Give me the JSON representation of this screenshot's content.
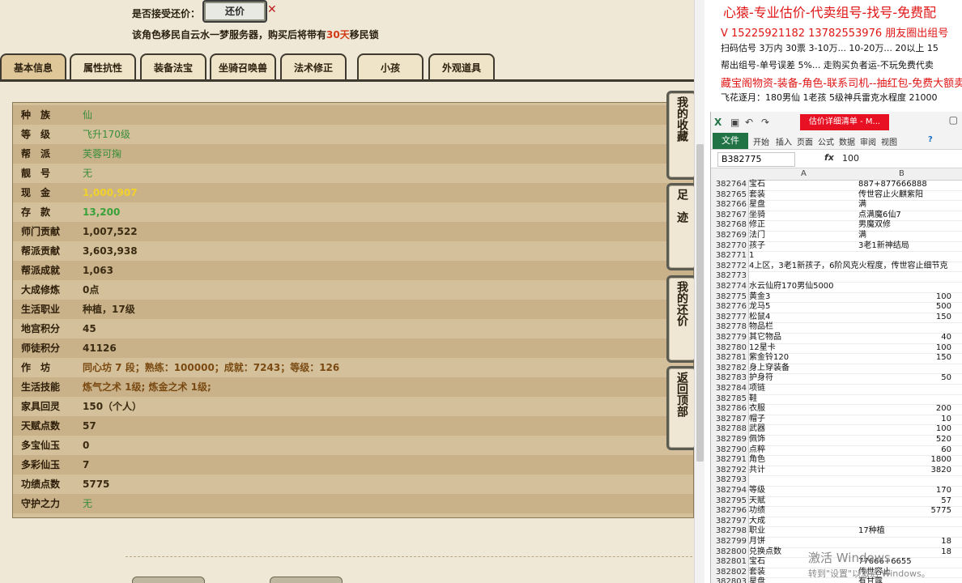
{
  "offer": {
    "question": "是否接受还价：",
    "button": "还价",
    "close": "✕"
  },
  "migration": {
    "prefix": "该角色移民自云水一梦服务器，购买后将带有",
    "days": "30天",
    "suffix": "移民锁"
  },
  "tabs": [
    "基本信息",
    "属性抗性",
    "装备法宝",
    "坐骑召唤兽",
    "法术修正",
    "小孩",
    "外观道具"
  ],
  "info": [
    {
      "k": "种　族",
      "v": "仙"
    },
    {
      "k": "等　级",
      "v": "飞升170级"
    },
    {
      "k": "帮　派",
      "v": "芙蓉可掬"
    },
    {
      "k": "靓　号",
      "v": "无"
    },
    {
      "k": "现　金",
      "v": "1,000,907"
    },
    {
      "k": "存　款",
      "v": "13,200"
    },
    {
      "k": "师门贡献",
      "v": "1,007,522"
    },
    {
      "k": "帮派贡献",
      "v": "3,603,938"
    },
    {
      "k": "帮派成就",
      "v": "1,063"
    },
    {
      "k": "大成修炼",
      "v": "0点"
    },
    {
      "k": "生活职业",
      "v": "种植，17级"
    },
    {
      "k": "地宫积分",
      "v": "45"
    },
    {
      "k": "师徒积分",
      "v": "41126"
    },
    {
      "k": "作　坊",
      "v": "同心坊 7 段；熟练：100000；成就：7243；等级：126"
    },
    {
      "k": "生活技能",
      "v": "炼气之术 1级; 炼金之术 1级;"
    },
    {
      "k": "家具回灵",
      "v": "150（个人）"
    },
    {
      "k": "天赋点数",
      "v": "57"
    },
    {
      "k": "多宝仙玉",
      "v": "0"
    },
    {
      "k": "多彩仙玉",
      "v": "7"
    },
    {
      "k": "功绩点数",
      "v": "5775"
    },
    {
      "k": "守护之力",
      "v": "无"
    }
  ],
  "side_buttons": [
    "我的收藏",
    "足迹",
    "我的还价",
    "返回顶部"
  ],
  "ads": {
    "line1": "心猿-专业估价-代卖组号-找号-免费配",
    "line2": "V 15225921182    13782553976 朋友圈出组号",
    "line3": "扫码估号 3万内 30票  3-10万... 10-20万... 20以上 15",
    "line4": "帮出组号-单号误差 5%... 走购买负者运-不玩免费代卖",
    "line5": "藏宝阁物资-装备-角色-联系司机--抽红包-免费大额卖",
    "line6": "飞花逐月：180男仙 1老孩 5级神兵雷克水程度 21000"
  },
  "excel": {
    "window_title": "估价详细清单 - M...",
    "ribbon": [
      "文件",
      "开始",
      "插入",
      "页面",
      "公式",
      "数据",
      "审阅",
      "视图"
    ],
    "name_box": "B382775",
    "formula_value": "100",
    "col_a": "A",
    "col_b": "B",
    "rows": [
      {
        "n": "382764",
        "a": "宝石",
        "b": "887+877666888",
        "num": false
      },
      {
        "n": "382765",
        "a": "套装",
        "b": "传世容止火麒紫阳",
        "num": false
      },
      {
        "n": "382766",
        "a": "星盘",
        "b": "满",
        "num": false
      },
      {
        "n": "382767",
        "a": "坐骑",
        "b": "点满魔6仙7",
        "num": false
      },
      {
        "n": "382768",
        "a": "修正",
        "b": "男魔双修",
        "num": false
      },
      {
        "n": "382769",
        "a": "法门",
        "b": "满",
        "num": false
      },
      {
        "n": "382770",
        "a": "孩子",
        "b": "3老1新神结局",
        "num": false
      },
      {
        "n": "382771",
        "a": "1",
        "b": "",
        "num": false
      },
      {
        "n": "382772",
        "a": "4上区，3老1新孩子，6阶风克火程度，传世容止细节克",
        "b": "",
        "num": false
      },
      {
        "n": "382773",
        "a": "",
        "b": "",
        "num": false
      },
      {
        "n": "382774",
        "a": "水云仙府170男仙5000",
        "b": "",
        "num": false
      },
      {
        "n": "382775",
        "a": "黄金3",
        "b": "100",
        "num": true
      },
      {
        "n": "382776",
        "a": "龙马5",
        "b": "500",
        "num": true
      },
      {
        "n": "382777",
        "a": "松鼠4",
        "b": "150",
        "num": true
      },
      {
        "n": "382778",
        "a": "物品栏",
        "b": "",
        "num": false
      },
      {
        "n": "382779",
        "a": "其它物品",
        "b": "40",
        "num": true
      },
      {
        "n": "382780",
        "a": "12星卡",
        "b": "100",
        "num": true
      },
      {
        "n": "382781",
        "a": "紫金铃120",
        "b": "150",
        "num": true
      },
      {
        "n": "382782",
        "a": "身上穿装备",
        "b": "",
        "num": false
      },
      {
        "n": "382783",
        "a": "护身符",
        "b": "50",
        "num": true
      },
      {
        "n": "382784",
        "a": "项链",
        "b": "",
        "num": false
      },
      {
        "n": "382785",
        "a": "鞋",
        "b": "",
        "num": false
      },
      {
        "n": "382786",
        "a": "衣服",
        "b": "200",
        "num": true
      },
      {
        "n": "382787",
        "a": "帽子",
        "b": "10",
        "num": true
      },
      {
        "n": "382788",
        "a": "武器",
        "b": "100",
        "num": true
      },
      {
        "n": "382789",
        "a": "佩饰",
        "b": "520",
        "num": true
      },
      {
        "n": "382790",
        "a": "点粹",
        "b": "60",
        "num": true
      },
      {
        "n": "382791",
        "a": "角色",
        "b": "1800",
        "num": true
      },
      {
        "n": "382792",
        "a": "共计",
        "b": "3820",
        "num": true
      },
      {
        "n": "382793",
        "a": "",
        "b": "",
        "num": false
      },
      {
        "n": "382794",
        "a": "等级",
        "b": "170",
        "num": true
      },
      {
        "n": "382795",
        "a": "天赋",
        "b": "57",
        "num": true
      },
      {
        "n": "382796",
        "a": "功绩",
        "b": "5775",
        "num": true
      },
      {
        "n": "382797",
        "a": "大成",
        "b": "",
        "num": false
      },
      {
        "n": "382798",
        "a": "职业",
        "b": "17种植",
        "num": false
      },
      {
        "n": "382799",
        "a": "月饼",
        "b": "18",
        "num": true
      },
      {
        "n": "382800",
        "a": "兑换点数",
        "b": "18",
        "num": true
      },
      {
        "n": "382801",
        "a": "宝石",
        "b": "77666+6655",
        "num": false
      },
      {
        "n": "382802",
        "a": "套装",
        "b": "传世容止",
        "num": false
      },
      {
        "n": "382803",
        "a": "星盘",
        "b": "有甘露",
        "num": false
      }
    ],
    "watermark1": "激活 Windows",
    "watermark2": "转到\"设置\"以激活 Windows。"
  }
}
